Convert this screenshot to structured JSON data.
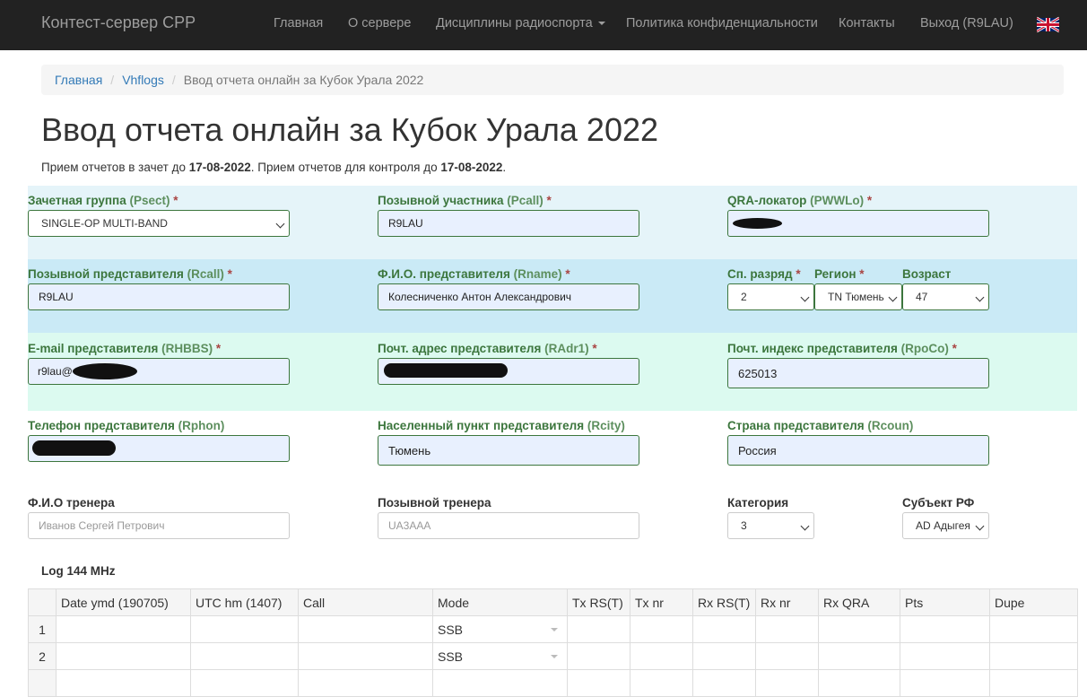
{
  "navbar": {
    "brand": "Контест-сервер СРР",
    "links": [
      "Главная",
      "О сервере",
      "Дисциплины радиоспорта",
      "Политика конфиденциальности",
      "Контакты",
      "Выход (R9LAU)"
    ]
  },
  "breadcrumb": {
    "items": [
      "Главная",
      "Vhflogs"
    ],
    "active": "Ввод отчета онлайн за Кубок Урала 2022"
  },
  "page": {
    "title": "Ввод отчета онлайн за Кубок Урала 2022",
    "info_prefix": "Прием отчетов в зачет до ",
    "deadline1": "17-08-2022",
    "info_mid": ". Прием отчетов для контроля до ",
    "deadline2": "17-08-2022",
    "info_suffix": "."
  },
  "form": {
    "psect": {
      "label": "Зачетная группа ",
      "code": "(Psect)",
      "value": "SINGLE-OP MULTI-BAND"
    },
    "pcall": {
      "label": "Позывной участника ",
      "code": "(Pcall)",
      "value": "R9LAU"
    },
    "pwwlo": {
      "label": "QRA-локатор ",
      "code": "(PWWLo)",
      "value": ""
    },
    "rcall": {
      "label": "Позывной представителя ",
      "code": "(Rcall)",
      "value": "R9LAU"
    },
    "rname": {
      "label": "Ф.И.О. представителя ",
      "code": "(Rname)",
      "value": "Колесниченко Антон Александрович"
    },
    "rank": {
      "label": "Сп. разряд ",
      "value": "2"
    },
    "region": {
      "label": "Регион ",
      "value": "TN Тюмень"
    },
    "age": {
      "label": "Возраст",
      "value": "47"
    },
    "rhbbs": {
      "label": "E-mail представителя ",
      "code": "(RHBBS)",
      "value": "r9lau@"
    },
    "radr1": {
      "label": "Почт. адрес представителя ",
      "code": "(RAdr1)",
      "value": ""
    },
    "rpoco": {
      "label": "Почт. индекс представителя ",
      "code": "(RpoCo)",
      "value": "625013"
    },
    "rphon": {
      "label": "Телефон представителя ",
      "code": "(Rphon)",
      "value": ""
    },
    "rcity": {
      "label": "Населенный пункт представителя ",
      "code": "(Rcity)",
      "value": "Тюмень"
    },
    "rcoun": {
      "label": "Страна представителя ",
      "code": "(Rcoun)",
      "value": "Россия"
    },
    "coach_name": {
      "label": "Ф.И.О тренера",
      "placeholder": "Иванов Сергей Петрович"
    },
    "coach_call": {
      "label": "Позывной тренера",
      "placeholder": "UA3AAA"
    },
    "category": {
      "label": "Категория",
      "value": "3"
    },
    "subject": {
      "label": "Субъект РФ",
      "value": "AD Адыгея"
    },
    "required_mark": "*"
  },
  "log": {
    "title": "Log 144 MHz",
    "columns": [
      "Date ymd (190705)",
      "UTC hm (1407)",
      "Call",
      "Mode",
      "Tx RS(T)",
      "Tx nr",
      "Rx RS(T)",
      "Rx nr",
      "Rx QRA",
      "Pts",
      "Dupe"
    ],
    "rows": [
      {
        "num": "1",
        "mode": "SSB"
      },
      {
        "num": "2",
        "mode": "SSB"
      }
    ]
  },
  "colors": {
    "navbar": "#222222",
    "label_green": "#3c763d",
    "band1": "#e5f4f9",
    "band2": "#caeaf6",
    "band3": "#dcfaf0",
    "input_fill": "#e8f0fe"
  }
}
